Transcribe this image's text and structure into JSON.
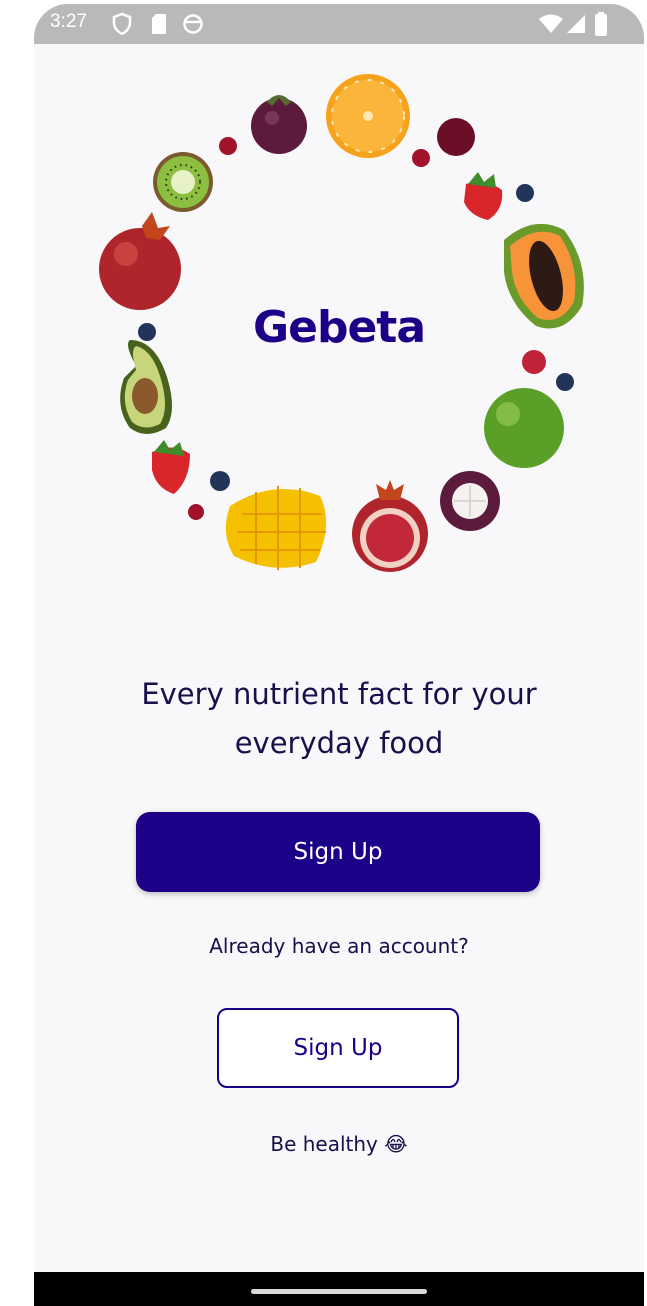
{
  "status_bar": {
    "time": "3:27",
    "left_icons": [
      "vpn-shield-icon",
      "sd-card-icon",
      "app-notification-icon"
    ],
    "right_icons": [
      "wifi-icon",
      "cell-signal-icon",
      "battery-icon"
    ]
  },
  "hero": {
    "logo_text": "Gebeta",
    "fruits": [
      "mangosteen",
      "orange",
      "grape",
      "strawberry",
      "blueberry",
      "papaya",
      "raspberry",
      "green-apple",
      "mango",
      "pomegranate",
      "avocado",
      "kiwi",
      "cranberry"
    ]
  },
  "tagline": "Every nutrient fact for your everyday food",
  "primary_button": {
    "label": "Sign Up"
  },
  "account_prompt": "Already have an account?",
  "secondary_button": {
    "label": "Sign Up"
  },
  "footer_text": "Be healthy 😂",
  "colors": {
    "brand": "#1d0088",
    "text": "#18104a",
    "background": "#f8f8fa",
    "status_bar": "#b9b9b9"
  }
}
